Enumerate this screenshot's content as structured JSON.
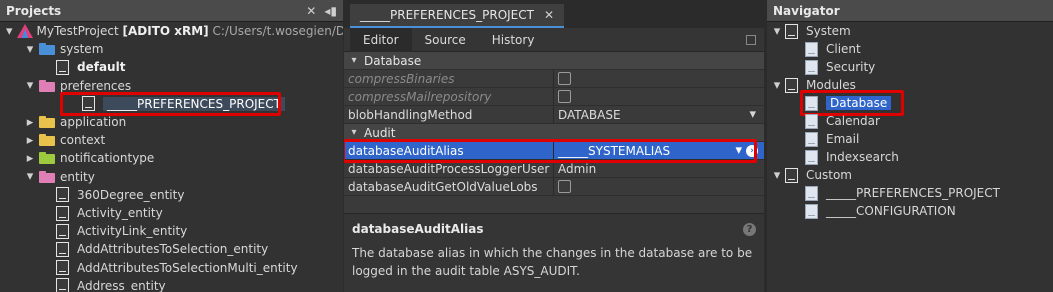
{
  "projects": {
    "title": "Projects",
    "close_glyph": "✕",
    "pin_glyph": "◂▮",
    "tree": [
      {
        "level": 0,
        "chevron": "open",
        "icon": "adito-logo-icon",
        "parts": [
          {
            "t": "MyTestProject ",
            "c": ""
          },
          {
            "t": "[ADITO xRM]",
            "c": "bold"
          },
          {
            "t": " C:/Users/t.wosegien/De",
            "c": "path"
          }
        ]
      },
      {
        "level": 1,
        "chevron": "open",
        "icon": "folder-blue",
        "label": "system"
      },
      {
        "level": 2,
        "chevron": "",
        "icon": "doc",
        "label": "default",
        "bold": true
      },
      {
        "level": 1,
        "chevron": "open",
        "icon": "folder-pink",
        "label": "preferences"
      },
      {
        "level": 2,
        "chevron": "",
        "icon": "doc",
        "label": "_____PREFERENCES_PROJECT",
        "highlight": true
      },
      {
        "level": 1,
        "chevron": "closed",
        "icon": "folder-yellow",
        "label": "application"
      },
      {
        "level": 1,
        "chevron": "closed",
        "icon": "folder-yellow",
        "label": "context"
      },
      {
        "level": 1,
        "chevron": "closed",
        "icon": "folder-green",
        "label": "notificationtype"
      },
      {
        "level": 1,
        "chevron": "open",
        "icon": "folder-pink",
        "label": "entity"
      },
      {
        "level": 2,
        "chevron": "",
        "icon": "doc",
        "label": "360Degree_entity"
      },
      {
        "level": 2,
        "chevron": "",
        "icon": "doc",
        "label": "Activity_entity"
      },
      {
        "level": 2,
        "chevron": "",
        "icon": "doc",
        "label": "ActivityLink_entity"
      },
      {
        "level": 2,
        "chevron": "",
        "icon": "doc",
        "label": "AddAttributesToSelection_entity"
      },
      {
        "level": 2,
        "chevron": "",
        "icon": "doc",
        "label": "AddAttributesToSelectionMulti_entity"
      },
      {
        "level": 2,
        "chevron": "",
        "icon": "doc",
        "label": "Address_entity"
      }
    ]
  },
  "editor": {
    "doc_tab": "_____PREFERENCES_PROJECT",
    "doc_tab_close": "✕",
    "subtabs": [
      "Editor",
      "Source",
      "History"
    ],
    "active_subtab": "Editor",
    "rows": [
      {
        "type": "category",
        "label": "Database"
      },
      {
        "type": "prop",
        "key": "compressBinaries",
        "dim": true,
        "kind": "checkbox"
      },
      {
        "type": "prop",
        "key": "compressMailrepository",
        "dim": true,
        "kind": "checkbox"
      },
      {
        "type": "prop",
        "key": "blobHandlingMethod",
        "kind": "dropdown",
        "value": "DATABASE"
      },
      {
        "type": "category",
        "label": "Audit"
      },
      {
        "type": "prop",
        "key": "databaseAuditAlias",
        "kind": "dropdown",
        "value": "_____SYSTEMALIAS",
        "selected": true
      },
      {
        "type": "prop",
        "key": "databaseAuditProcessLoggerUser",
        "kind": "text",
        "value": "Admin"
      },
      {
        "type": "prop",
        "key": "databaseAuditGetOldValueLobs",
        "kind": "checkbox"
      }
    ],
    "help": {
      "title": "databaseAuditAlias",
      "text": "The database alias in which the changes in the database are to be logged in the audit table ASYS_AUDIT."
    }
  },
  "navigator": {
    "title": "Navigator",
    "tree": [
      {
        "level": 0,
        "chevron": "open",
        "label": "System",
        "filled": false
      },
      {
        "level": 1,
        "chevron": "",
        "label": "Client",
        "filled": true
      },
      {
        "level": 1,
        "chevron": "",
        "label": "Security",
        "filled": true
      },
      {
        "level": 0,
        "chevron": "open",
        "label": "Modules",
        "filled": false
      },
      {
        "level": 1,
        "chevron": "",
        "label": "Database",
        "filled": true,
        "highlight": true
      },
      {
        "level": 1,
        "chevron": "",
        "label": "Calendar",
        "filled": true
      },
      {
        "level": 1,
        "chevron": "",
        "label": "Email",
        "filled": true
      },
      {
        "level": 1,
        "chevron": "",
        "label": "Indexsearch",
        "filled": true
      },
      {
        "level": 0,
        "chevron": "open",
        "label": "Custom",
        "filled": false
      },
      {
        "level": 1,
        "chevron": "",
        "label": "_____PREFERENCES_PROJECT",
        "filled": true
      },
      {
        "level": 1,
        "chevron": "",
        "label": "_____CONFIGURATION",
        "filled": true
      }
    ]
  },
  "colors": {
    "highlight_border": "#e00000",
    "selection_blue": "#2f65ca",
    "tab_underline": "#4a90d9"
  }
}
